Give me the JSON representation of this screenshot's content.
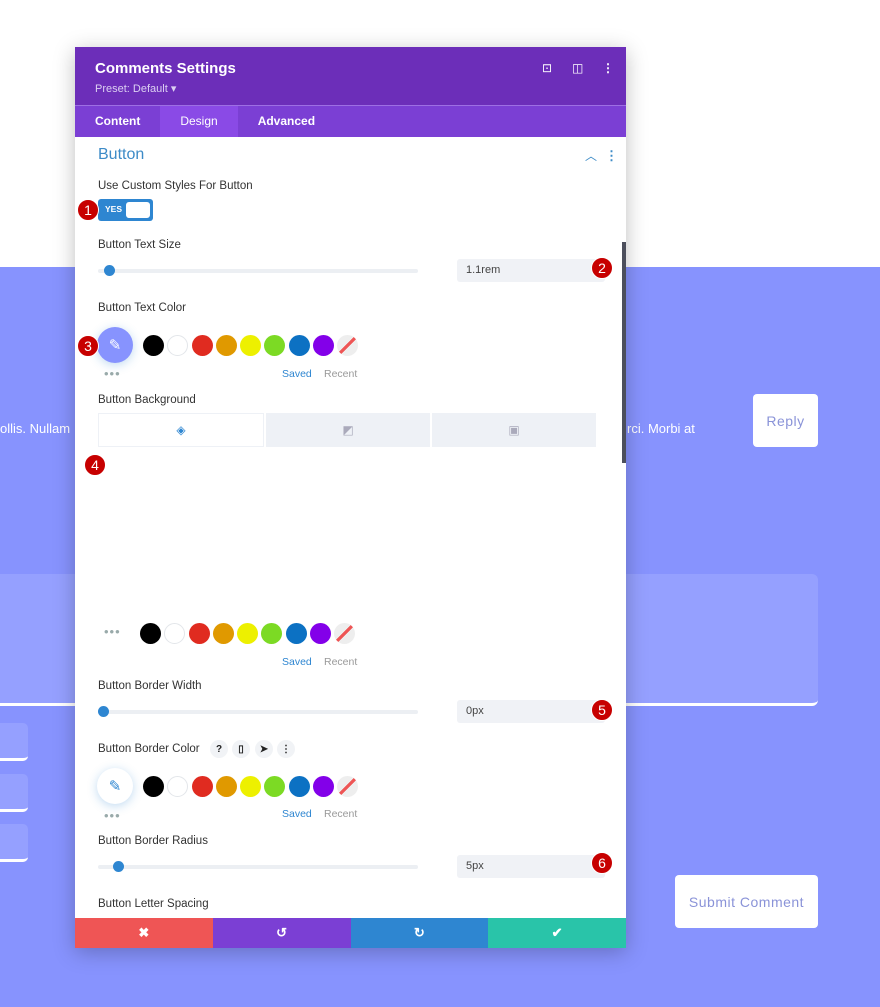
{
  "page": {
    "left_text": "ollis. Nullam",
    "right_text": "rci. Morbi at",
    "reply_button": "Reply",
    "submit_button": "Submit Comment"
  },
  "panel": {
    "title": "Comments Settings",
    "preset": "Preset: Default ▾",
    "header_icons": [
      "focus-icon",
      "split-view-icon",
      "more-vertical-icon"
    ],
    "tabs": [
      {
        "label": "Content"
      },
      {
        "label": "Design",
        "active": true
      },
      {
        "label": "Advanced"
      }
    ],
    "section_title": "Button",
    "custom_styles": {
      "label": "Use Custom Styles For Button",
      "value": "YES"
    },
    "text_size": {
      "label": "Button Text Size",
      "value": "1.1rem",
      "slider_fraction": 0.02
    },
    "text_color": {
      "label": "Button Text Color",
      "picker_color": "#8793fe"
    },
    "background": {
      "label": "Button Background",
      "tabs": [
        "color-fill-icon",
        "gradient-icon",
        "image-icon"
      ]
    },
    "border_width": {
      "label": "Button Border Width",
      "value": "0px",
      "slider_fraction": 0.0
    },
    "border_color": {
      "label": "Button Border Color",
      "help": "?",
      "icons": [
        "help-icon",
        "mobile-icon",
        "cursor-icon",
        "more-vertical-icon"
      ]
    },
    "border_radius": {
      "label": "Button Border Radius",
      "value": "5px",
      "slider_fraction": 0.05
    },
    "letter_spacing": {
      "label": "Button Letter Spacing"
    },
    "swatches": [
      "#000000",
      "#ffffff",
      "#e02b20",
      "#e09900",
      "#edf000",
      "#7cda24",
      "#0c71c3",
      "#8300e9"
    ],
    "saved_label": "Saved",
    "recent_label": "Recent",
    "more_label": "•••",
    "footer": [
      {
        "name": "cancel",
        "icon": "✖",
        "color": "#ef5555"
      },
      {
        "name": "undo",
        "icon": "↺",
        "color": "#7b3fd4"
      },
      {
        "name": "redo",
        "icon": "↻",
        "color": "#2e86d1"
      },
      {
        "name": "save",
        "icon": "✔",
        "color": "#29c4a9"
      }
    ]
  },
  "badges": [
    "1",
    "2",
    "3",
    "4",
    "5",
    "6"
  ]
}
